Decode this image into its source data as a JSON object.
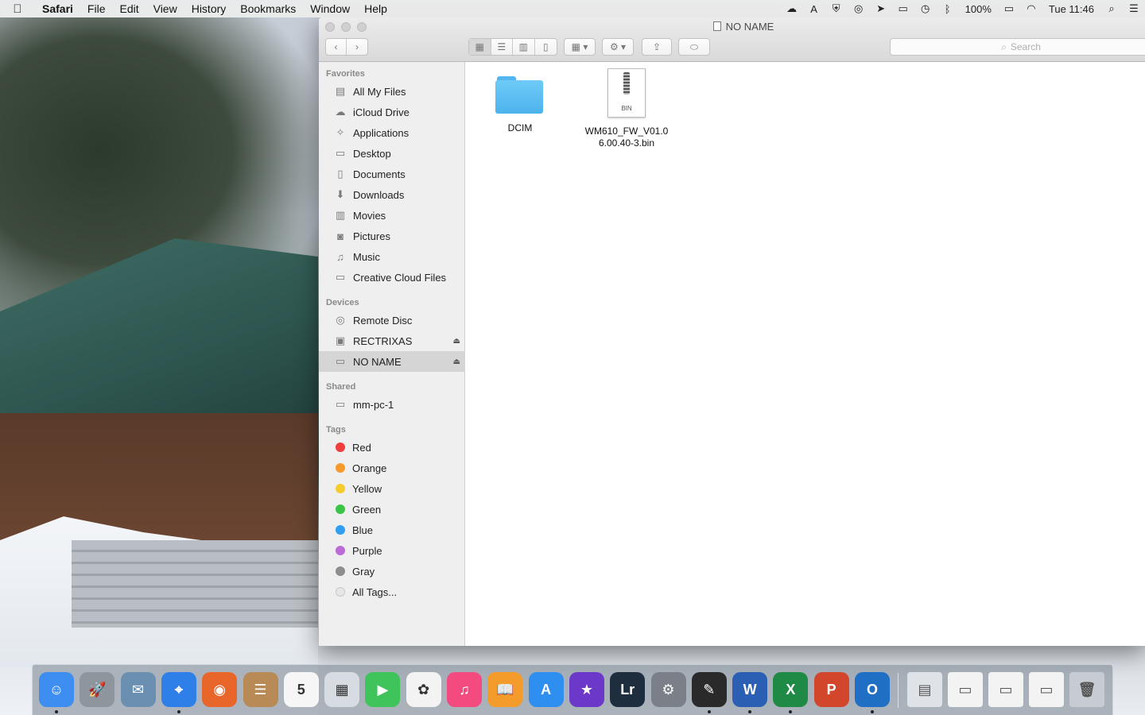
{
  "menubar": {
    "app": "Safari",
    "menus": [
      "File",
      "Edit",
      "View",
      "History",
      "Bookmarks",
      "Window",
      "Help"
    ],
    "battery": "100%",
    "clock": "Tue 11:46"
  },
  "window": {
    "title": "NO NAME",
    "search_placeholder": "Search"
  },
  "sidebar": {
    "favorites_header": "Favorites",
    "favorites": [
      {
        "label": "All My Files",
        "icon": "all-files-icon"
      },
      {
        "label": "iCloud Drive",
        "icon": "cloud-icon"
      },
      {
        "label": "Applications",
        "icon": "applications-icon"
      },
      {
        "label": "Desktop",
        "icon": "desktop-icon"
      },
      {
        "label": "Documents",
        "icon": "documents-icon"
      },
      {
        "label": "Downloads",
        "icon": "downloads-icon"
      },
      {
        "label": "Movies",
        "icon": "movies-icon"
      },
      {
        "label": "Pictures",
        "icon": "pictures-icon"
      },
      {
        "label": "Music",
        "icon": "music-icon"
      },
      {
        "label": "Creative Cloud Files",
        "icon": "folder-icon"
      }
    ],
    "devices_header": "Devices",
    "devices": [
      {
        "label": "Remote Disc",
        "icon": "disc-icon"
      },
      {
        "label": "RECTRIXAS",
        "icon": "drive-icon"
      },
      {
        "label": "NO NAME",
        "icon": "drive-icon"
      }
    ],
    "shared_header": "Shared",
    "shared": [
      {
        "label": "mm-pc-1",
        "icon": "computer-icon"
      }
    ],
    "tags_header": "Tags",
    "tags": [
      {
        "label": "Red",
        "color": "#f03d3d"
      },
      {
        "label": "Orange",
        "color": "#f59a2b"
      },
      {
        "label": "Yellow",
        "color": "#f5cb2e"
      },
      {
        "label": "Green",
        "color": "#3cc446"
      },
      {
        "label": "Blue",
        "color": "#2f9ef0"
      },
      {
        "label": "Purple",
        "color": "#bb6ad6"
      },
      {
        "label": "Gray",
        "color": "#8d8d8d"
      },
      {
        "label": "All Tags...",
        "color": "#e6e6e6"
      }
    ]
  },
  "content": {
    "items": [
      {
        "label": "DCIM",
        "type": "folder"
      },
      {
        "label_line1": "WM610_FW_V01.0",
        "label_line2": "6.00.40-3.bin",
        "type": "bin",
        "ext": "BIN"
      }
    ]
  },
  "dock": {
    "apps": [
      {
        "name": "finder-icon",
        "color": "#3d8ef0",
        "glyph": "☺"
      },
      {
        "name": "launchpad-icon",
        "color": "#8e959c",
        "glyph": "🚀"
      },
      {
        "name": "mail-stamp-icon",
        "color": "#6b8fb0",
        "glyph": "✉"
      },
      {
        "name": "safari-icon",
        "color": "#2f7fe8",
        "glyph": "⌖"
      },
      {
        "name": "firefox-icon",
        "color": "#e8662a",
        "glyph": "◉"
      },
      {
        "name": "contacts-icon",
        "color": "#b88a55",
        "glyph": "☰"
      },
      {
        "name": "calendar-icon",
        "color": "#f6f6f6",
        "glyph": "5"
      },
      {
        "name": "preview-icon",
        "color": "#d7dce2",
        "glyph": "▦"
      },
      {
        "name": "facetime-icon",
        "color": "#3ec45a",
        "glyph": "▶"
      },
      {
        "name": "photos-icon",
        "color": "#f3f3f3",
        "glyph": "✿"
      },
      {
        "name": "itunes-icon",
        "color": "#f34a80",
        "glyph": "♫"
      },
      {
        "name": "ibooks-icon",
        "color": "#f39b2b",
        "glyph": "📖"
      },
      {
        "name": "app-store-icon",
        "color": "#2f8ff0",
        "glyph": "A"
      },
      {
        "name": "imovie-icon",
        "color": "#6b38c9",
        "glyph": "★"
      },
      {
        "name": "lightroom-icon",
        "color": "#1e2e3e",
        "glyph": "Lr"
      },
      {
        "name": "system-preferences-icon",
        "color": "#7b8088",
        "glyph": "⚙"
      },
      {
        "name": "acrobat-icon",
        "color": "#2a2a2a",
        "glyph": "✎"
      },
      {
        "name": "word-icon",
        "color": "#2b5fb3",
        "glyph": "W"
      },
      {
        "name": "excel-icon",
        "color": "#1f8a45",
        "glyph": "X"
      },
      {
        "name": "powerpoint-icon",
        "color": "#d2472b",
        "glyph": "P"
      },
      {
        "name": "outlook-icon",
        "color": "#1f6fc4",
        "glyph": "O"
      }
    ],
    "docs": [
      {
        "name": "downloads-stack-icon",
        "color": "#dfe3e8",
        "glyph": "▤"
      },
      {
        "name": "word-doc-thumb-icon",
        "color": "#f3f3f3",
        "glyph": "▭"
      },
      {
        "name": "outlook-doc-thumb-icon",
        "color": "#f3f3f3",
        "glyph": "▭"
      },
      {
        "name": "safari-doc-thumb-icon",
        "color": "#f3f3f3",
        "glyph": "▭"
      },
      {
        "name": "trash-icon",
        "color": "#c7ccd2",
        "glyph": "🗑"
      }
    ]
  }
}
